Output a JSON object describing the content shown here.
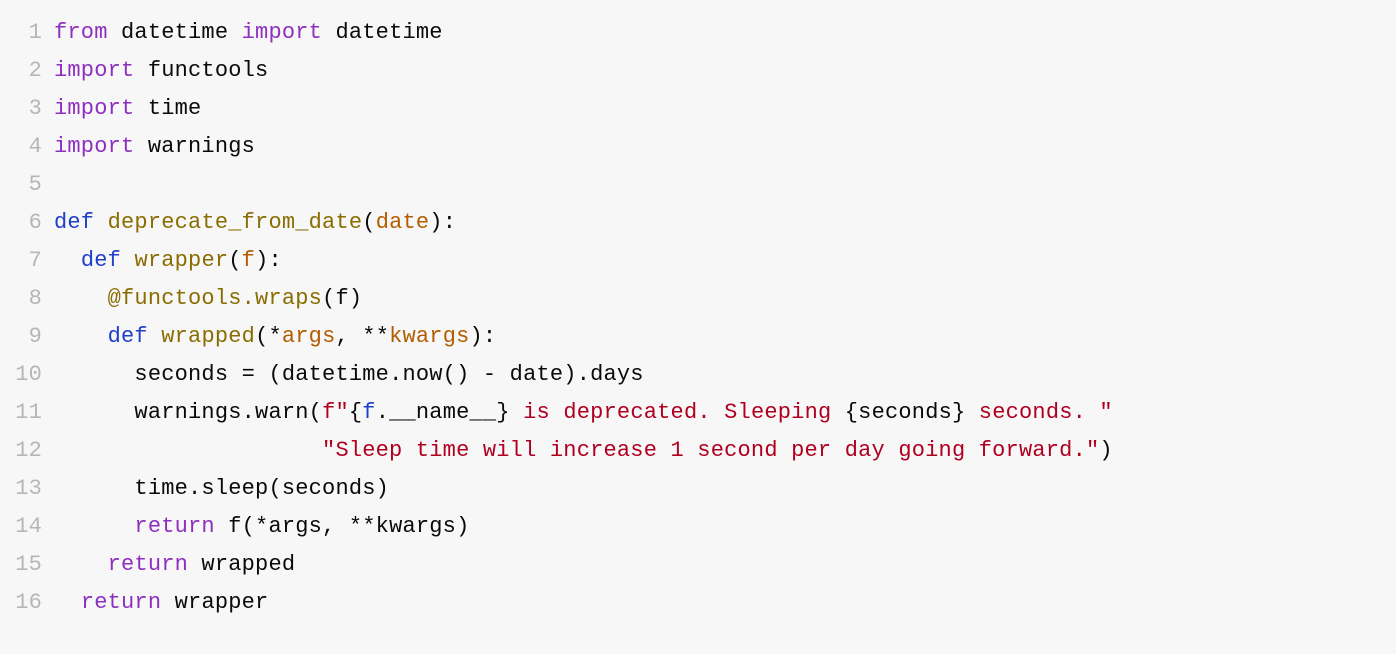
{
  "lines": [
    {
      "n": "1",
      "ind": 0,
      "tokens": [
        {
          "c": "kw",
          "t": "from"
        },
        {
          "c": "plain",
          "t": " datetime "
        },
        {
          "c": "kw",
          "t": "import"
        },
        {
          "c": "plain",
          "t": " datetime"
        }
      ]
    },
    {
      "n": "2",
      "ind": 0,
      "tokens": [
        {
          "c": "kw",
          "t": "import"
        },
        {
          "c": "plain",
          "t": " functools"
        }
      ]
    },
    {
      "n": "3",
      "ind": 0,
      "tokens": [
        {
          "c": "kw",
          "t": "import"
        },
        {
          "c": "plain",
          "t": " time"
        }
      ]
    },
    {
      "n": "4",
      "ind": 0,
      "tokens": [
        {
          "c": "kw",
          "t": "import"
        },
        {
          "c": "plain",
          "t": " warnings"
        }
      ]
    },
    {
      "n": "5",
      "ind": 0,
      "tokens": []
    },
    {
      "n": "6",
      "ind": 0,
      "tokens": [
        {
          "c": "def",
          "t": "def"
        },
        {
          "c": "plain",
          "t": " "
        },
        {
          "c": "fn",
          "t": "deprecate_from_date"
        },
        {
          "c": "plain",
          "t": "("
        },
        {
          "c": "param",
          "t": "date"
        },
        {
          "c": "plain",
          "t": "):"
        }
      ]
    },
    {
      "n": "7",
      "ind": 2,
      "tokens": [
        {
          "c": "def",
          "t": "def"
        },
        {
          "c": "plain",
          "t": " "
        },
        {
          "c": "fn",
          "t": "wrapper"
        },
        {
          "c": "plain",
          "t": "("
        },
        {
          "c": "param",
          "t": "f"
        },
        {
          "c": "plain",
          "t": "):"
        }
      ]
    },
    {
      "n": "8",
      "ind": 4,
      "tokens": [
        {
          "c": "fn",
          "t": "@functools.wraps"
        },
        {
          "c": "plain",
          "t": "(f)"
        }
      ]
    },
    {
      "n": "9",
      "ind": 4,
      "tokens": [
        {
          "c": "def",
          "t": "def"
        },
        {
          "c": "plain",
          "t": " "
        },
        {
          "c": "fn",
          "t": "wrapped"
        },
        {
          "c": "plain",
          "t": "(*"
        },
        {
          "c": "param",
          "t": "args"
        },
        {
          "c": "plain",
          "t": ", **"
        },
        {
          "c": "param",
          "t": "kwargs"
        },
        {
          "c": "plain",
          "t": "):"
        }
      ]
    },
    {
      "n": "10",
      "ind": 6,
      "tokens": [
        {
          "c": "plain",
          "t": "seconds = (datetime.now() - date).days"
        }
      ]
    },
    {
      "n": "11",
      "ind": 6,
      "tokens": [
        {
          "c": "plain",
          "t": "warnings.warn("
        },
        {
          "c": "str",
          "t": "f\""
        },
        {
          "c": "plain",
          "t": "{"
        },
        {
          "c": "fexpr",
          "t": "f"
        },
        {
          "c": "plain",
          "t": ".__name__}"
        },
        {
          "c": "str",
          "t": " is deprecated. Sleeping "
        },
        {
          "c": "plain",
          "t": "{seconds}"
        },
        {
          "c": "str",
          "t": " seconds. \""
        }
      ]
    },
    {
      "n": "12",
      "ind": 20,
      "tokens": [
        {
          "c": "str",
          "t": "\"Sleep time will increase 1 second per day going forward.\""
        },
        {
          "c": "plain",
          "t": ")"
        }
      ]
    },
    {
      "n": "13",
      "ind": 6,
      "tokens": [
        {
          "c": "plain",
          "t": "time.sleep(seconds)"
        }
      ]
    },
    {
      "n": "14",
      "ind": 6,
      "tokens": [
        {
          "c": "kw",
          "t": "return"
        },
        {
          "c": "plain",
          "t": " f(*args, **kwargs)"
        }
      ]
    },
    {
      "n": "15",
      "ind": 4,
      "tokens": [
        {
          "c": "kw",
          "t": "return"
        },
        {
          "c": "plain",
          "t": " wrapped"
        }
      ]
    },
    {
      "n": "16",
      "ind": 2,
      "tokens": [
        {
          "c": "kw",
          "t": "return"
        },
        {
          "c": "plain",
          "t": " wrapper"
        }
      ]
    }
  ]
}
